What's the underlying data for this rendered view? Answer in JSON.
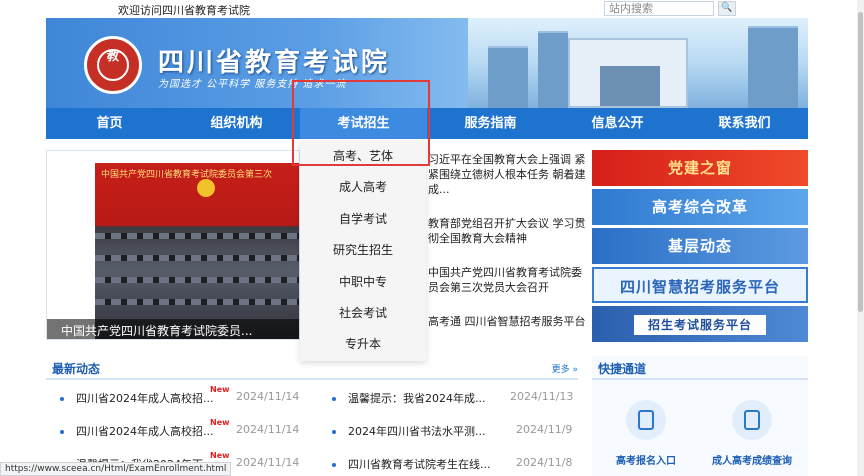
{
  "topbar": {
    "welcome": "欢迎访问四川省教育考试院",
    "search_placeholder": "站内搜索",
    "search_btn": "🔍"
  },
  "banner": {
    "title": "四川省教育考试院",
    "slogan": "为国选才 公平科学 服务支持 追求一流",
    "logo_glyph": "教"
  },
  "nav": {
    "items": [
      "首页",
      "组织机构",
      "考试招生",
      "服务指南",
      "信息公开",
      "联系我们"
    ],
    "active": "考试招生"
  },
  "dropdown": {
    "items": [
      "高考、艺体",
      "成人高考",
      "自学考试",
      "研究生招生",
      "中职中专",
      "社会考试",
      "专升本"
    ]
  },
  "slider": {
    "caption": "中国共产党四川省教育考试院委员...",
    "stage_text": "中国共产党四川省教育考试院委员会第三次"
  },
  "headlines": [
    "习近平在全国教育大会上强调 紧紧围绕立德树人根本任务 朝着建成...",
    "教育部党组召开扩大会议 学习贯彻全国教育大会精神",
    "中国共产党四川省教育考试院委员会第三次党员大会召开",
    "高考通 四川省智慧招考服务平台"
  ],
  "right_banners": [
    "党建之窗",
    "高考综合改革",
    "基层动态",
    "四川智慧招考服务平台",
    "招生考试服务平台"
  ],
  "news": {
    "title": "最新动态",
    "more": "更多 »",
    "new_tag": "New",
    "left": [
      {
        "text": "四川省2024年成人高校招...",
        "date": "2024/11/14",
        "is_new": true
      },
      {
        "text": "四川省2024年成人高校招...",
        "date": "2024/11/14",
        "is_new": true
      },
      {
        "text": "温馨提示：我省2024年下...",
        "date": "2024/11/14",
        "is_new": true
      }
    ],
    "right": [
      {
        "text": "温馨提示：我省2024年成...",
        "date": "2024/11/13"
      },
      {
        "text": "2024年四川省书法水平测...",
        "date": "2024/11/9"
      },
      {
        "text": "四川省教育考试院考生在线...",
        "date": "2024/11/8"
      }
    ]
  },
  "quick": {
    "title": "快捷通道",
    "items": [
      "高考报名入口",
      "成人高考成绩查询"
    ]
  },
  "statusbar": {
    "url": "https://www.sceea.cn/Html/ExamEnrollment.html"
  }
}
